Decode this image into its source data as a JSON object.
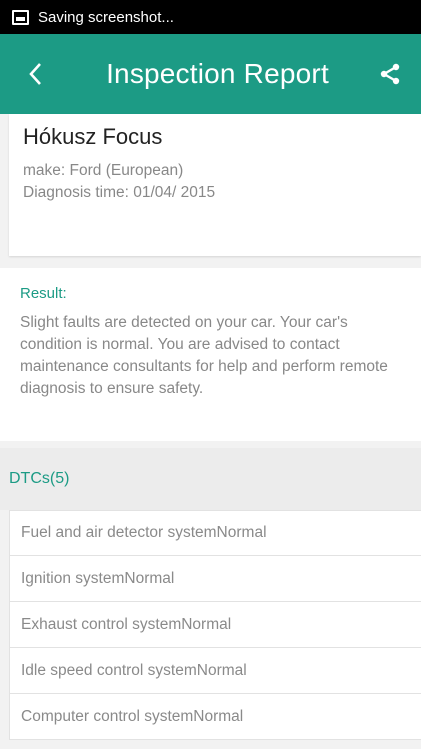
{
  "status_bar": {
    "text": "Saving screenshot..."
  },
  "app_bar": {
    "title": "Inspection Report",
    "back_icon": "back-chevron-icon",
    "share_icon": "share-icon"
  },
  "vehicle": {
    "name": "Hókusz Focus",
    "make": "make: Ford (European)",
    "diagnosis_time": "Diagnosis time: 01/04/ 2015"
  },
  "result": {
    "label": "Result:",
    "text": "Slight faults are detected on your car. Your car's condition is normal. You are advised to contact maintenance consultants for help and perform remote diagnosis to ensure safety."
  },
  "dtcs": {
    "header": "DTCs(5)",
    "items": [
      "Fuel and air detector systemNormal",
      "Ignition systemNormal",
      "Exhaust control systemNormal",
      "Idle speed control systemNormal",
      "Computer control systemNormal"
    ]
  },
  "colors": {
    "accent": "#1c9b85",
    "status_bar": "#000000"
  }
}
